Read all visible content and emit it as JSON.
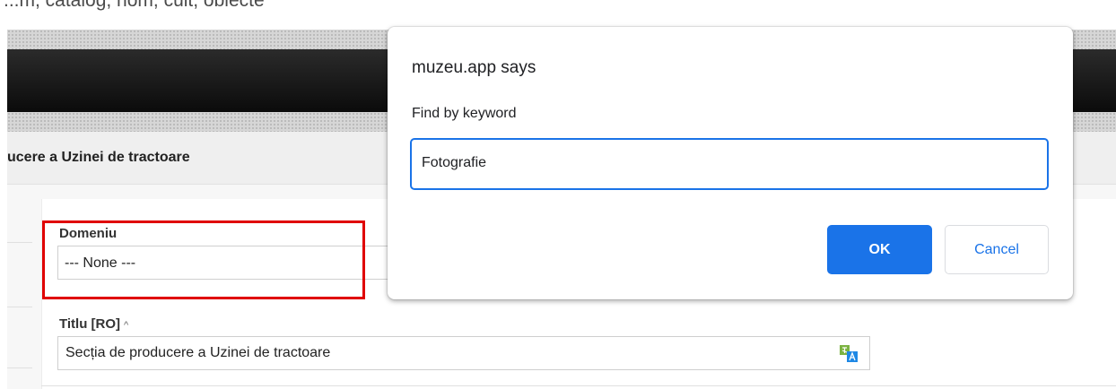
{
  "browser": {
    "partial_top_text": "...m, catalog, nom, cult, obiecte"
  },
  "page": {
    "title": "ucere a Uzinei de tractoare",
    "fields": {
      "domeniu": {
        "label": "Domeniu",
        "value": "--- None ---"
      },
      "titlu": {
        "label": "Titlu [RO]",
        "hint": "^",
        "value": "Secția de producere a Uzinei de tractoare"
      }
    }
  },
  "dialog": {
    "title": "muzeu.app says",
    "message": "Find by keyword",
    "input_value": "Fotografie",
    "ok_label": "OK",
    "cancel_label": "Cancel"
  },
  "colors": {
    "accent": "#1a73e8",
    "highlight": "#e00000",
    "header": "#111111"
  }
}
